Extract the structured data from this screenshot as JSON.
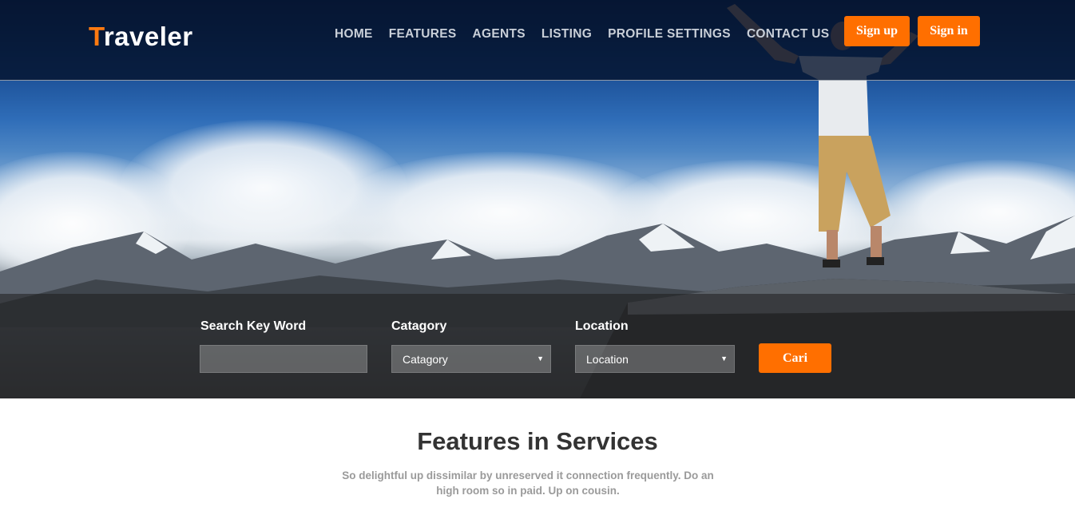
{
  "brand": {
    "first_letter": "T",
    "rest": "raveler",
    "accent": "#ff7a10"
  },
  "nav": {
    "items": [
      {
        "label": "HOME"
      },
      {
        "label": "FEATURES"
      },
      {
        "label": "AGENTS"
      },
      {
        "label": "LISTING"
      },
      {
        "label": "PROFILE SETTINGS"
      },
      {
        "label": "CONTACT US"
      }
    ],
    "signup_label": "Sign up",
    "signin_label": "Sign in"
  },
  "search": {
    "keyword_label": "Search Key Word",
    "keyword_value": "",
    "category_label": "Catagory",
    "category_selected": "Catagory",
    "location_label": "Location",
    "location_selected": "Location",
    "submit_label": "Cari"
  },
  "features": {
    "title": "Features in Services",
    "description": "So delightful up dissimilar by unreserved it connection frequently. Do an high room so in paid. Up on cousin."
  },
  "colors": {
    "button": "#ff6f00",
    "topbar": "#04122a"
  }
}
